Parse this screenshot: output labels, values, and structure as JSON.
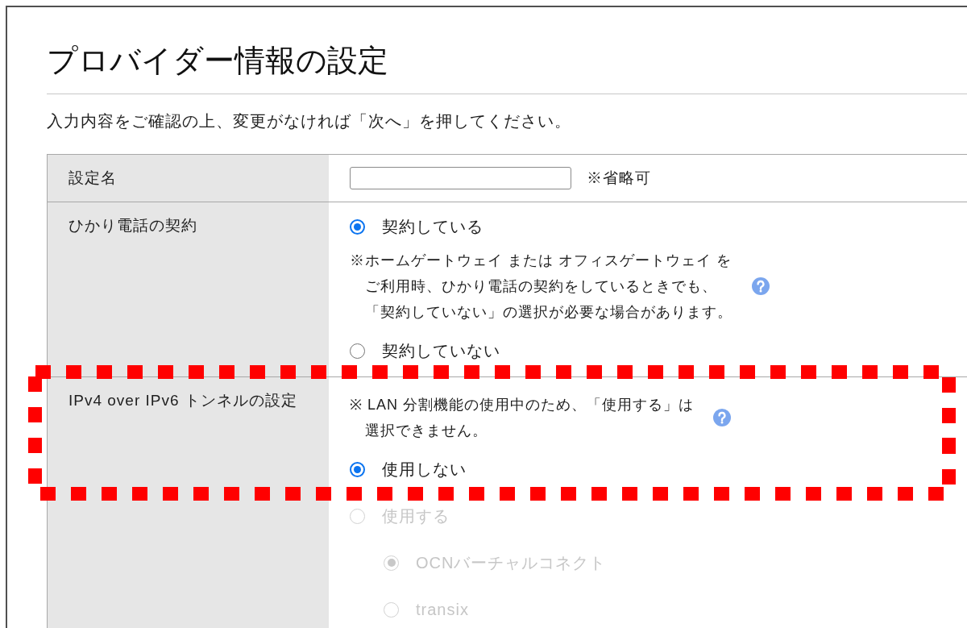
{
  "page": {
    "title": "プロバイダー情報の設定",
    "instruction": "入力内容をご確認の上、変更がなければ「次へ」を押してください。"
  },
  "settings": [
    {
      "label": "設定名",
      "kind": "text",
      "highlighted": false,
      "note": "※省略可"
    },
    {
      "label": "ひかり電話の契約",
      "kind": "radio",
      "highlighted": false,
      "items": [
        {
          "kind": "option",
          "label": "契約している",
          "selected": true,
          "disabled": false
        },
        {
          "kind": "note",
          "lines": [
            "※ホームゲートウェイ または オフィスゲートウェイ を",
            "ご利用時、ひかり電話の契約をしているときでも、",
            "「契約していない」の選択が必要な場合があります。"
          ],
          "help": true
        },
        {
          "kind": "option",
          "label": "契約していない",
          "selected": false,
          "disabled": false
        }
      ]
    },
    {
      "label": "IPv4 over IPv6 トンネルの設定",
      "kind": "radio",
      "highlighted": true,
      "items": [
        {
          "kind": "note",
          "lines": [
            "※ LAN 分割機能の使用中のため、「使用する」は",
            "選択できません。"
          ],
          "help": true
        },
        {
          "kind": "option",
          "label": "使用しない",
          "selected": true,
          "disabled": false
        },
        {
          "kind": "option",
          "label": "使用する",
          "selected": false,
          "disabled": true,
          "children": [
            {
              "label": "OCNバーチャルコネクト",
              "selected": true,
              "disabled": true
            },
            {
              "label": "transix",
              "selected": false,
              "disabled": true
            }
          ]
        }
      ]
    }
  ]
}
